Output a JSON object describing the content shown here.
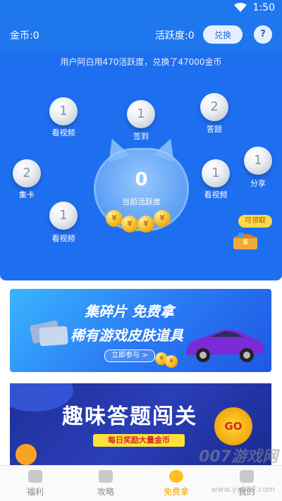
{
  "status_bar": {
    "time": "1:50"
  },
  "header": {
    "coins_label": "金币:0",
    "activity_label": "活跃度:0",
    "exchange_button": "兑换",
    "help_button": "?"
  },
  "ticker": "用户阿白用470活跃度，兑换了47000金币",
  "task_balls": [
    {
      "value": "1",
      "label": "看视频"
    },
    {
      "value": "1",
      "label": "签到"
    },
    {
      "value": "2",
      "label": "答题"
    },
    {
      "value": "2",
      "label": "集卡"
    },
    {
      "value": "1",
      "label": "看视频"
    },
    {
      "value": "1",
      "label": "分享"
    },
    {
      "value": "1",
      "label": "看视频"
    }
  ],
  "center": {
    "value": "0",
    "label": "当前活跃度"
  },
  "claim_badge": "可领取",
  "banner1": {
    "title": "集碎片 免费拿",
    "subtitle": "稀有游戏皮肤道具",
    "button": "立即参与 >"
  },
  "banner2": {
    "title": "趣味答题闯关",
    "subtitle": "每日奖励大量金币",
    "go": "GO"
  },
  "tabs": [
    {
      "label": "福利",
      "icon": "gift-icon"
    },
    {
      "label": "攻略",
      "icon": "bag-icon"
    },
    {
      "label": "免费拿",
      "icon": "free-icon",
      "active": true
    },
    {
      "label": "我的",
      "icon": "user-icon"
    }
  ],
  "watermark": {
    "text": "007游戏网",
    "url": "www.yx007.com"
  }
}
